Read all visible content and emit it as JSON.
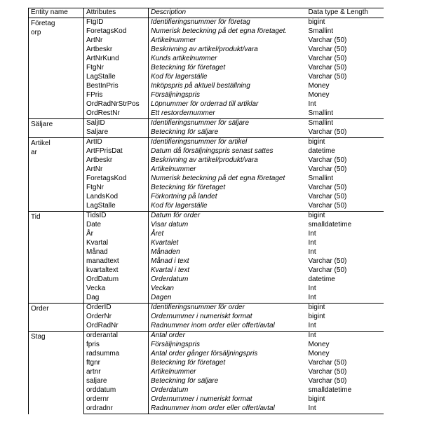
{
  "document": {
    "type": "data-dictionary-table",
    "language": "sv"
  },
  "table": {
    "headers": {
      "entity_name": "Entity name",
      "attributes": "Attributes",
      "description": "Description",
      "data_type": "Data type & Length"
    },
    "groups": [
      {
        "entity_lines": [
          "Företag",
          "orp"
        ],
        "rows": [
          {
            "attribute": "FtgID",
            "description": "Identifieringsnummer för företag",
            "type": "bigint"
          },
          {
            "attribute": "ForetagsKod",
            "description": "Numerisk beteckning på det egna företaget.",
            "type": "Smallint"
          },
          {
            "attribute": "ArtNr",
            "description": "Artikelnummer",
            "type": "Varchar (50)"
          },
          {
            "attribute": "Artbeskr",
            "description": "Beskrivning av artikel/produkt/vara",
            "type": "Varchar (50)"
          },
          {
            "attribute": "ArtNrKund",
            "description": "Kunds artikelnummer",
            "type": "Varchar (50)"
          },
          {
            "attribute": "FtgNr",
            "description": "Beteckning för företaget",
            "type": "Varchar (50)"
          },
          {
            "attribute": "LagStalle",
            "description": "Kod för lagerställe",
            "type": "Varchar (50)"
          },
          {
            "attribute": "BestInPris",
            "description": "Inköpspris på aktuell beställning",
            "type": "Money"
          },
          {
            "attribute": "FPris",
            "description": "Försäljningspris",
            "type": "Money"
          },
          {
            "attribute": "OrdRadNrStrPos",
            "description": "Löpnummer för orderrad till artiklar",
            "type": "Int"
          },
          {
            "attribute": "OrdRestNr",
            "description": "Ett restordernummer",
            "type": "Smallint"
          }
        ]
      },
      {
        "entity_lines": [
          "Säljare"
        ],
        "rows": [
          {
            "attribute": "SaljID",
            "description": "Identifieringsnummer för säljare",
            "type": "Smallint"
          },
          {
            "attribute": "Saljare",
            "description": "Beteckning för säljare",
            "type": "Varchar (50)"
          }
        ]
      },
      {
        "entity_lines": [
          "Artikel",
          "ar"
        ],
        "rows": [
          {
            "attribute": "ArtID",
            "description": "Identifieringsnummer för artikel",
            "type": "bigint"
          },
          {
            "attribute": "ArtFPrisDat",
            "description": "Datum då försäljningspris senast sattes",
            "type": "datetime"
          },
          {
            "attribute": "Artbeskr",
            "description": "Beskrivning av artikel/produkt/vara",
            "type": "Varchar (50)"
          },
          {
            "attribute": "ArtNr",
            "description": "Artikelnummer",
            "type": "Varchar (50)"
          },
          {
            "attribute": "ForetagsKod",
            "description": "Numerisk beteckning på det egna företaget",
            "type": "Smallint"
          },
          {
            "attribute": "FtgNr",
            "description": "Beteckning för företaget",
            "type": "Varchar (50)"
          },
          {
            "attribute": "LandsKod",
            "description": "Förkortning på landet",
            "type": "Varchar (50)"
          },
          {
            "attribute": "LagStalle",
            "description": "Kod för lagerställe",
            "type": "Varchar (50)"
          }
        ]
      },
      {
        "entity_lines": [
          "Tid"
        ],
        "rows": [
          {
            "attribute": "TidsID",
            "description": "Datum för order",
            "type": "bigint"
          },
          {
            "attribute": "Date",
            "description": "Visar datum",
            "type": "smalldatetime"
          },
          {
            "attribute": "År",
            "description": "Året",
            "type": "Int"
          },
          {
            "attribute": "Kvartal",
            "description": "Kvartalet",
            "type": "Int"
          },
          {
            "attribute": "Månad",
            "description": "Månaden",
            "type": "Int"
          },
          {
            "attribute": "manadtext",
            "description": "Månad i text",
            "type": "Varchar (50)"
          },
          {
            "attribute": "kvartaltext",
            "description": "Kvartal i text",
            "type": "Varchar (50)"
          },
          {
            "attribute": "OrdDatum",
            "description": "Orderdatum",
            "type": "datetime"
          },
          {
            "attribute": "Vecka",
            "description": "Veckan",
            "type": "Int"
          },
          {
            "attribute": "Dag",
            "description": "Dagen",
            "type": "Int"
          }
        ]
      },
      {
        "entity_lines": [
          "Order"
        ],
        "rows": [
          {
            "attribute": "OrderID",
            "description": "Identifieringsnummer för order",
            "type": "bigint"
          },
          {
            "attribute": "OrderNr",
            "description": "Ordernummer i numeriskt format",
            "type": "bigint"
          },
          {
            "attribute": "OrdRadNr",
            "description": "Radnummer inom order eller offert/avtal",
            "type": "Int"
          }
        ]
      },
      {
        "entity_lines": [
          "Stag"
        ],
        "rows": [
          {
            "attribute": "orderantal",
            "description": "Antal order",
            "type": "Int"
          },
          {
            "attribute": "fpris",
            "description": "Försäljningspris",
            "type": "Money"
          },
          {
            "attribute": "radsumma",
            "description": "Antal order gånger försäljningspris",
            "type": "Money"
          },
          {
            "attribute": "ftgnr",
            "description": "Beteckning för företaget",
            "type": "Varchar (50)"
          },
          {
            "attribute": "artnr",
            "description": "Artikelnummer",
            "type": "Varchar (50)"
          },
          {
            "attribute": "saljare",
            "description": "Beteckning för säljare",
            "type": "Varchar (50)"
          },
          {
            "attribute": "orddatum",
            "description": "Orderdatum",
            "type": "smalldatetime"
          },
          {
            "attribute": "ordernr",
            "description": "Ordernummer i numeriskt format",
            "type": "bigint"
          },
          {
            "attribute": "ordradnr",
            "description": "Radnummer inom order eller offert/avtal",
            "type": "Int"
          }
        ]
      }
    ]
  }
}
